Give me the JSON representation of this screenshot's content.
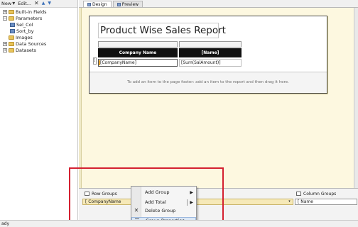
{
  "left_pane": {
    "toolbar": {
      "new_label": "New",
      "edit_label": "Edit..."
    },
    "tree": {
      "built_in_fields": "Built-in Fields",
      "parameters": "Parameters",
      "sel_col": "Sel_Col",
      "sort_by": "Sort_by",
      "images": "Images",
      "data_sources": "Data Sources",
      "datasets": "Datasets"
    }
  },
  "tabs": {
    "design": "Design",
    "preview": "Preview"
  },
  "report": {
    "title": "Product Wise Sales Report",
    "table": {
      "header_company": "Company Name",
      "header_name": "[Name]",
      "cell_company": "[CompanyName]",
      "cell_amount": "[Sum(SalAmount)]"
    },
    "footer_hint": "To add an item to the page footer: add an item to the report and then drag it here."
  },
  "grouping": {
    "row_groups_label": "Row Groups",
    "row_group_value": "[ CompanyName",
    "column_groups_label": "Column Groups",
    "column_group_value": "[ Name"
  },
  "context_menu": {
    "add_group": "Add Group",
    "add_total": "Add Total",
    "delete_group": "Delete Group",
    "group_properties": "Group Properties..."
  },
  "status": {
    "text": "ady"
  },
  "colors": {
    "highlight_box": "#d42030",
    "design_surface": "#fdf8e0",
    "header_fill": "#111111"
  }
}
